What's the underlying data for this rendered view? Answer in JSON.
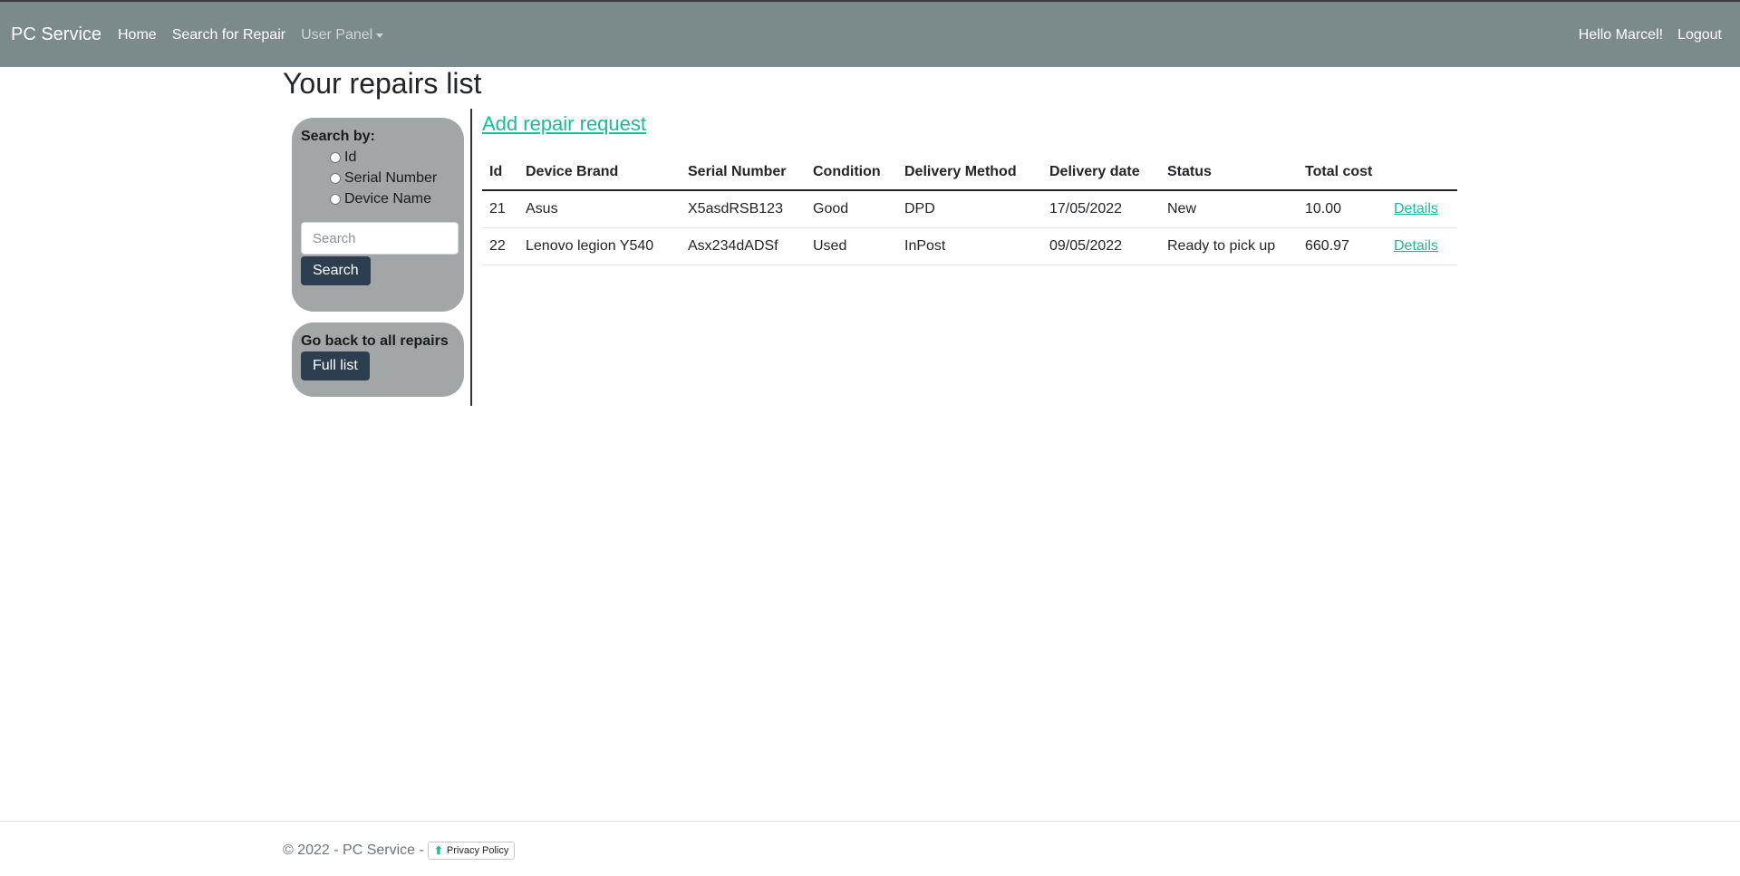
{
  "navbar": {
    "brand": "PC Service",
    "links": [
      "Home",
      "Search for Repair"
    ],
    "user_panel": "User Panel",
    "greeting": "Hello Marcel!",
    "logout": "Logout"
  },
  "page": {
    "title": "Your repairs list"
  },
  "sidebar": {
    "search_by_label": "Search by:",
    "options": [
      "Id",
      "Serial Number",
      "Device Name"
    ],
    "search_placeholder": "Search",
    "search_button": "Search",
    "back_label": "Go back to all repairs",
    "full_list_button": "Full list"
  },
  "main": {
    "add_link": "Add repair request",
    "columns": [
      "Id",
      "Device Brand",
      "Serial Number",
      "Condition",
      "Delivery Method",
      "Delivery date",
      "Status",
      "Total cost",
      ""
    ],
    "rows": [
      [
        "21",
        "Asus",
        "X5asdRSB123",
        "Good",
        "DPD",
        "17/05/2022",
        "New",
        "10.00",
        "Details"
      ],
      [
        "22",
        "Lenovo legion Y540",
        "Asx234dADSf",
        "Used",
        "InPost",
        "09/05/2022",
        "Ready to pick up",
        "660.97",
        "Details"
      ]
    ]
  },
  "footer": {
    "text": "© 2022 - PC Service -",
    "privacy": "Privacy Policy"
  },
  "colors": {
    "navbar": "#7b8a8b",
    "accent": "#18bc9c",
    "button": "#2c3e50",
    "card": "#a3a6a6"
  }
}
